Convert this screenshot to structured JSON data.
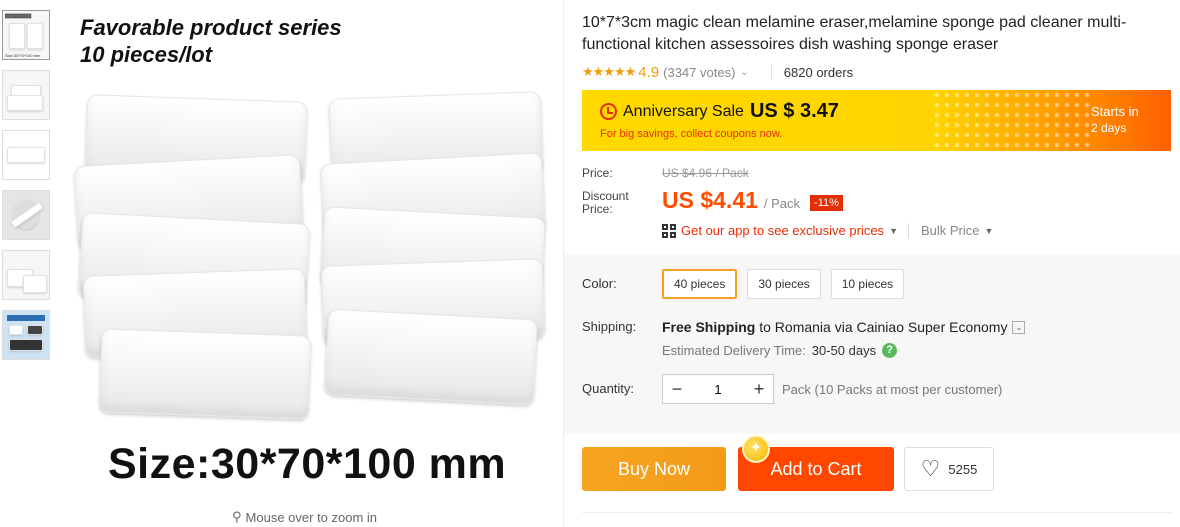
{
  "thumbnails": [
    {
      "caption": "Size:30*70*100 mm"
    },
    {
      "caption": ""
    },
    {
      "caption": ""
    },
    {
      "caption": ""
    },
    {
      "caption": ""
    },
    {
      "caption": ""
    }
  ],
  "gallery": {
    "image_title_line1": "Favorable product series",
    "image_title_line2": "10 pieces/lot",
    "size_text": "Size:30*70*100 mm",
    "zoom_hint": "Mouse over to zoom in"
  },
  "product": {
    "title": "10*7*3cm magic clean melamine eraser,melamine sponge pad cleaner multi-functional kitchen assessoires dish washing sponge eraser",
    "stars": "★★★★★",
    "rating": "4.9",
    "votes": "(3347 votes)",
    "orders": "6820 orders"
  },
  "sale": {
    "label": "Anniversary Sale",
    "price": "US $ 3.47",
    "subtitle": "For big savings, collect coupons now.",
    "starts_line1": "Starts in",
    "starts_line2": "2 days"
  },
  "pricing": {
    "price_label": "Price:",
    "original": "US $4.96 / Pack",
    "discount_label": "Discount Price:",
    "discount_value": "US $4.41",
    "discount_unit": "/ Pack",
    "discount_badge": "-11%",
    "app_link": "Get our app to see exclusive prices",
    "bulk_price": "Bulk Price"
  },
  "options": {
    "color_label": "Color:",
    "colors": [
      "40 pieces",
      "30 pieces",
      "10 pieces"
    ],
    "selected_color": "40 pieces",
    "shipping_label": "Shipping:",
    "shipping_free": "Free Shipping",
    "shipping_rest": " to Romania via Cainiao Super Economy",
    "estimated_label": "Estimated Delivery Time:",
    "estimated_days": "30-50 days",
    "quantity_label": "Quantity:",
    "quantity_value": "1",
    "quantity_note": "Pack (10 Packs at most per customer)"
  },
  "actions": {
    "buy_now": "Buy Now",
    "add_to_cart": "Add to Cart",
    "wishlist_count": "5255"
  },
  "colors": {
    "accent": "#ff4700",
    "buy": "#f5a623",
    "discount": "#e62e04",
    "rating": "#f39c0b"
  }
}
